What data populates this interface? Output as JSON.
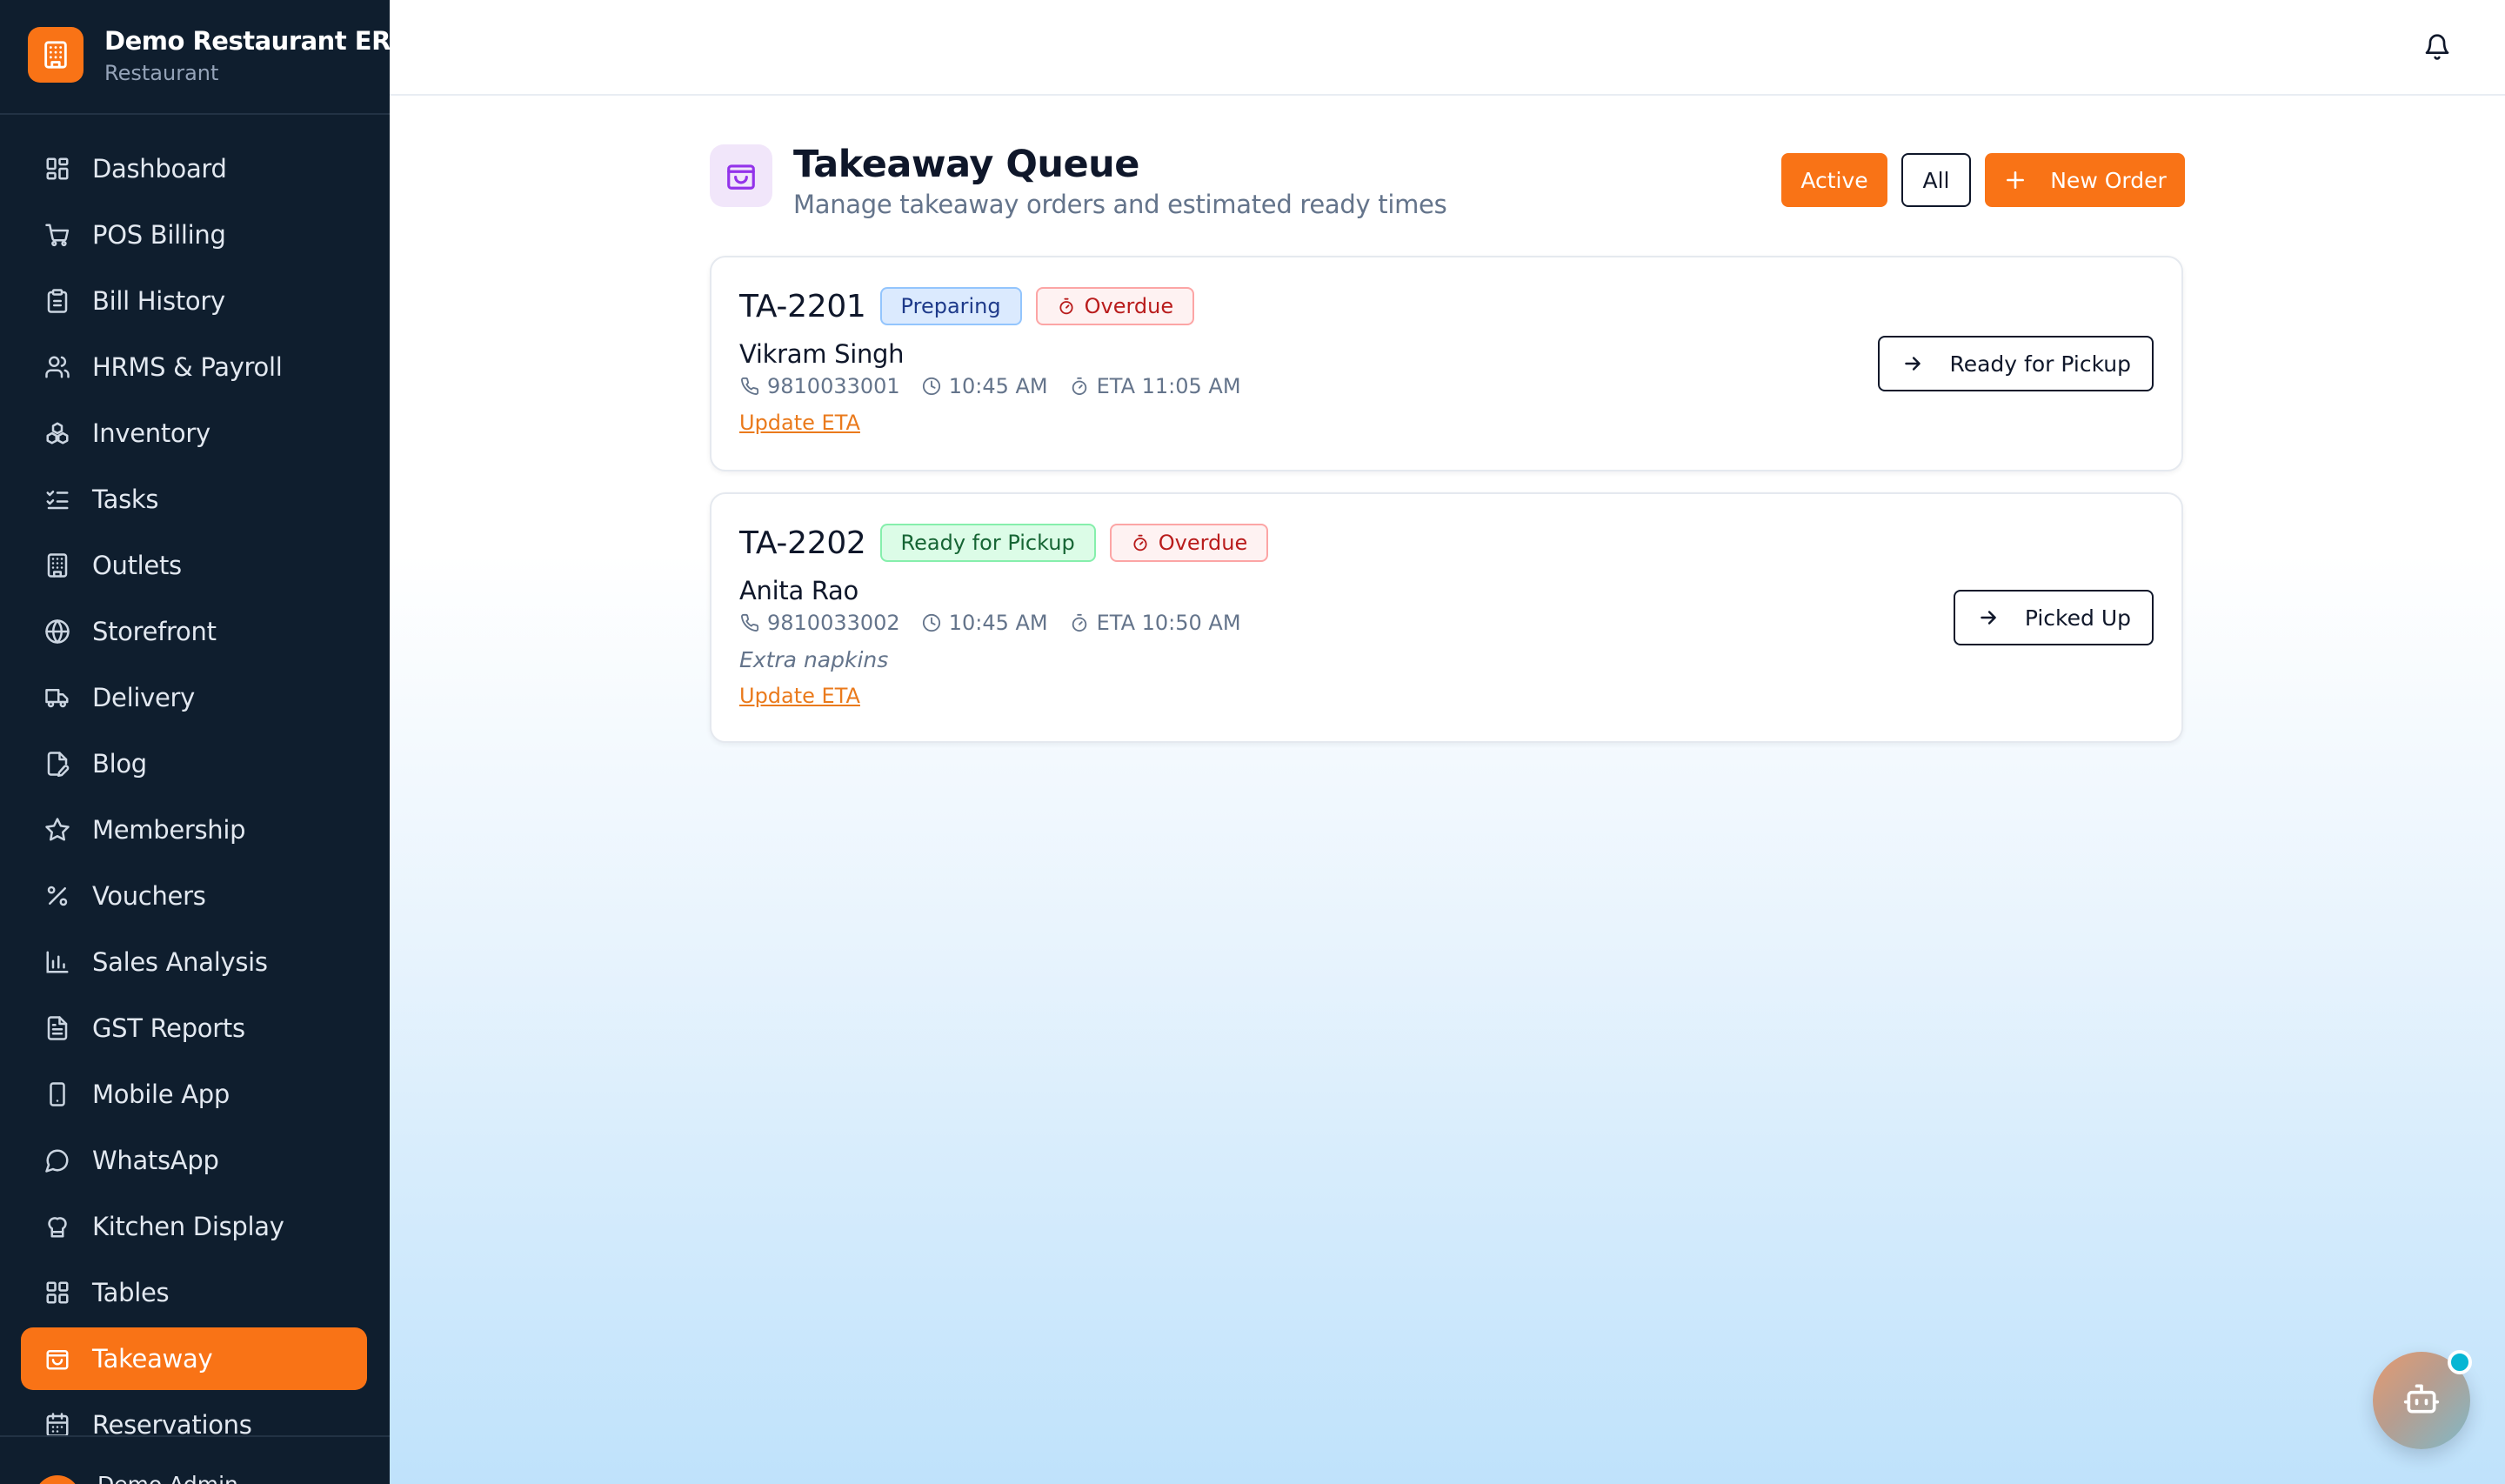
{
  "brand": {
    "title": "Demo Restaurant ERP",
    "subtitle": "Restaurant"
  },
  "sidebar": {
    "items": [
      {
        "label": "Dashboard",
        "icon": "dashboard-icon"
      },
      {
        "label": "POS Billing",
        "icon": "cart-icon"
      },
      {
        "label": "Bill History",
        "icon": "clipboard-icon"
      },
      {
        "label": "HRMS & Payroll",
        "icon": "users-icon"
      },
      {
        "label": "Inventory",
        "icon": "boxes-icon"
      },
      {
        "label": "Tasks",
        "icon": "checklist-icon"
      },
      {
        "label": "Outlets",
        "icon": "building-icon"
      },
      {
        "label": "Storefront",
        "icon": "globe-icon"
      },
      {
        "label": "Delivery",
        "icon": "truck-icon"
      },
      {
        "label": "Blog",
        "icon": "file-pen-icon"
      },
      {
        "label": "Membership",
        "icon": "star-icon"
      },
      {
        "label": "Vouchers",
        "icon": "percent-icon"
      },
      {
        "label": "Sales Analysis",
        "icon": "bar-chart-icon"
      },
      {
        "label": "GST Reports",
        "icon": "file-text-icon"
      },
      {
        "label": "Mobile App",
        "icon": "smartphone-icon"
      },
      {
        "label": "WhatsApp",
        "icon": "chat-icon"
      },
      {
        "label": "Kitchen Display",
        "icon": "chef-hat-icon"
      },
      {
        "label": "Tables",
        "icon": "grid-icon"
      },
      {
        "label": "Takeaway",
        "icon": "shopping-bag-icon"
      },
      {
        "label": "Reservations",
        "icon": "calendar-icon"
      }
    ],
    "active": "Takeaway",
    "user_name": "Demo Admin"
  },
  "header": {
    "title": "Takeaway Queue",
    "subtitle": "Manage takeaway orders and estimated ready times",
    "filter_active": "Active",
    "filter_all": "All",
    "new_order": "New Order"
  },
  "orders": [
    {
      "id": "TA-2201",
      "status": "Preparing",
      "flag": "Overdue",
      "customer": "Vikram Singh",
      "phone": "9810033001",
      "time": "10:45 AM",
      "eta": "ETA 11:05 AM",
      "note": "",
      "update_label": "Update ETA",
      "action": "Ready for Pickup"
    },
    {
      "id": "TA-2202",
      "status": "Ready for Pickup",
      "flag": "Overdue",
      "customer": "Anita Rao",
      "phone": "9810033002",
      "time": "10:45 AM",
      "eta": "ETA 10:50 AM",
      "note": "Extra napkins",
      "update_label": "Update ETA",
      "action": "Picked Up"
    }
  ],
  "colors": {
    "accent": "#f97316",
    "sidebar_bg": "#0f1e2e",
    "preparing": "#1e3a8a",
    "ready": "#166534",
    "overdue": "#b91c1c"
  }
}
